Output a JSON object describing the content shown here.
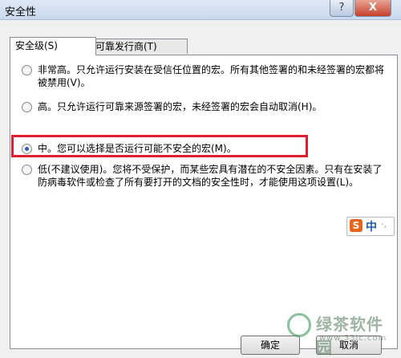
{
  "window": {
    "title": "安全性",
    "help_label": "?",
    "close_label": "X"
  },
  "tabs": [
    {
      "label": "安全级(S)",
      "active": true
    },
    {
      "label": "可靠发行商(T)",
      "active": false
    }
  ],
  "options": [
    {
      "label": "非常高。只允许运行安装在受信任位置的宏。所有其他签署的和未经签署的宏都将被禁用(V)。",
      "selected": false
    },
    {
      "label": "高。只允许运行可靠来源签署的宏，未经签署的宏会自动取消(H)。",
      "selected": false
    },
    {
      "label": "中。您可以选择是否运行可能不安全的宏(M)。",
      "selected": true
    },
    {
      "label": "低(不建议使用)。您将不受保护，而某些宏具有潜在的不安全因素。只有在安装了防病毒软件或检查了所有要打开的文档的安全性时，才能使用这项设置(L)。",
      "selected": false
    }
  ],
  "ime": {
    "logo": "S",
    "mode": "中",
    "extra": "·,"
  },
  "buttons": {
    "ok": "确定",
    "cancel": "取消"
  },
  "watermark": {
    "text": "绿茶软件园",
    "url": "www.33lc.com"
  },
  "colors": {
    "highlight": "#e01e2e",
    "accent": "#2b5fb4"
  }
}
